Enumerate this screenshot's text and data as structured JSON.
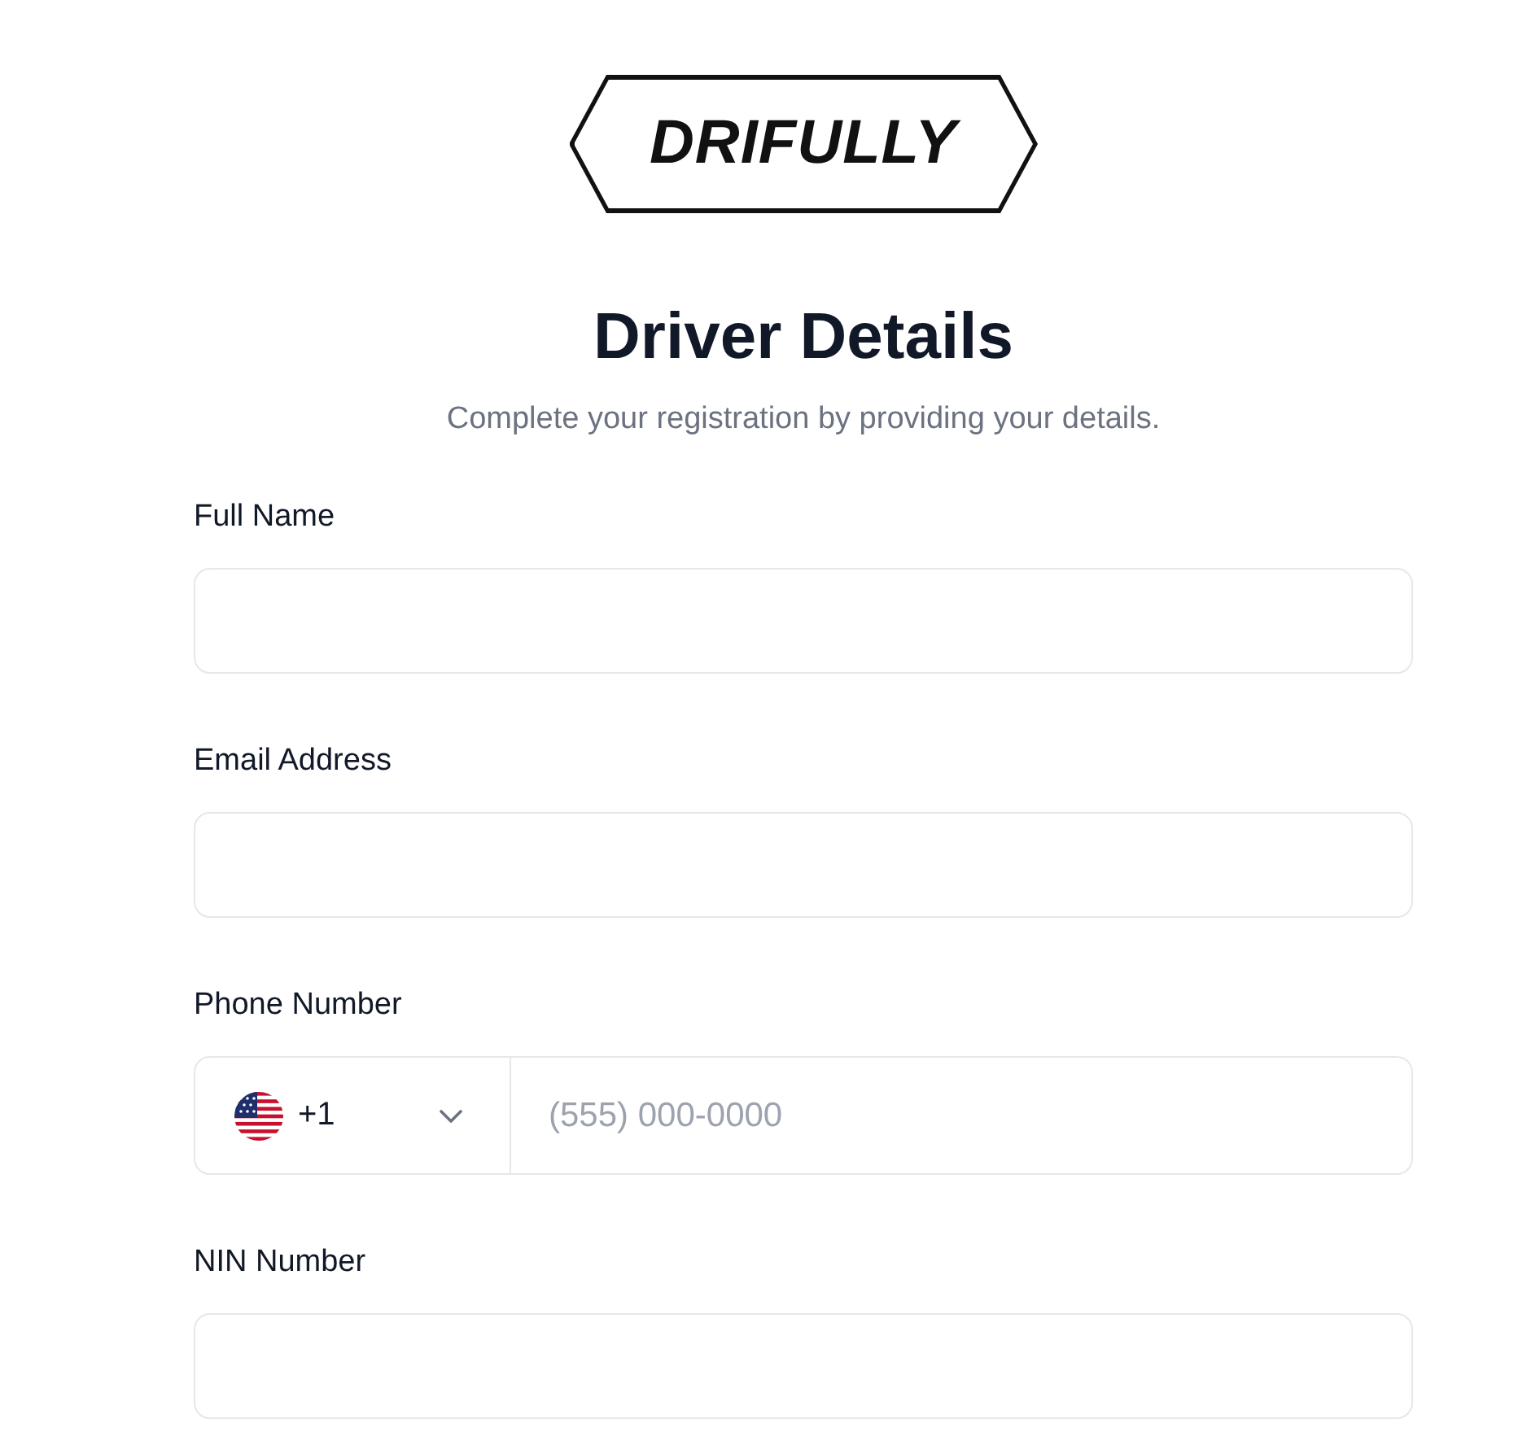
{
  "logo": {
    "text": "DRIFULLY"
  },
  "heading": {
    "title": "Driver Details",
    "subtitle": "Complete your registration by providing your details."
  },
  "fields": [
    {
      "kind": "text",
      "label": "Full Name"
    },
    {
      "kind": "text",
      "label": "Email Address"
    },
    {
      "kind": "phone",
      "label": "Phone Number",
      "country_code": "+1",
      "placeholder": "(555) 000-0000"
    },
    {
      "kind": "text",
      "label": "NIN Number"
    }
  ]
}
